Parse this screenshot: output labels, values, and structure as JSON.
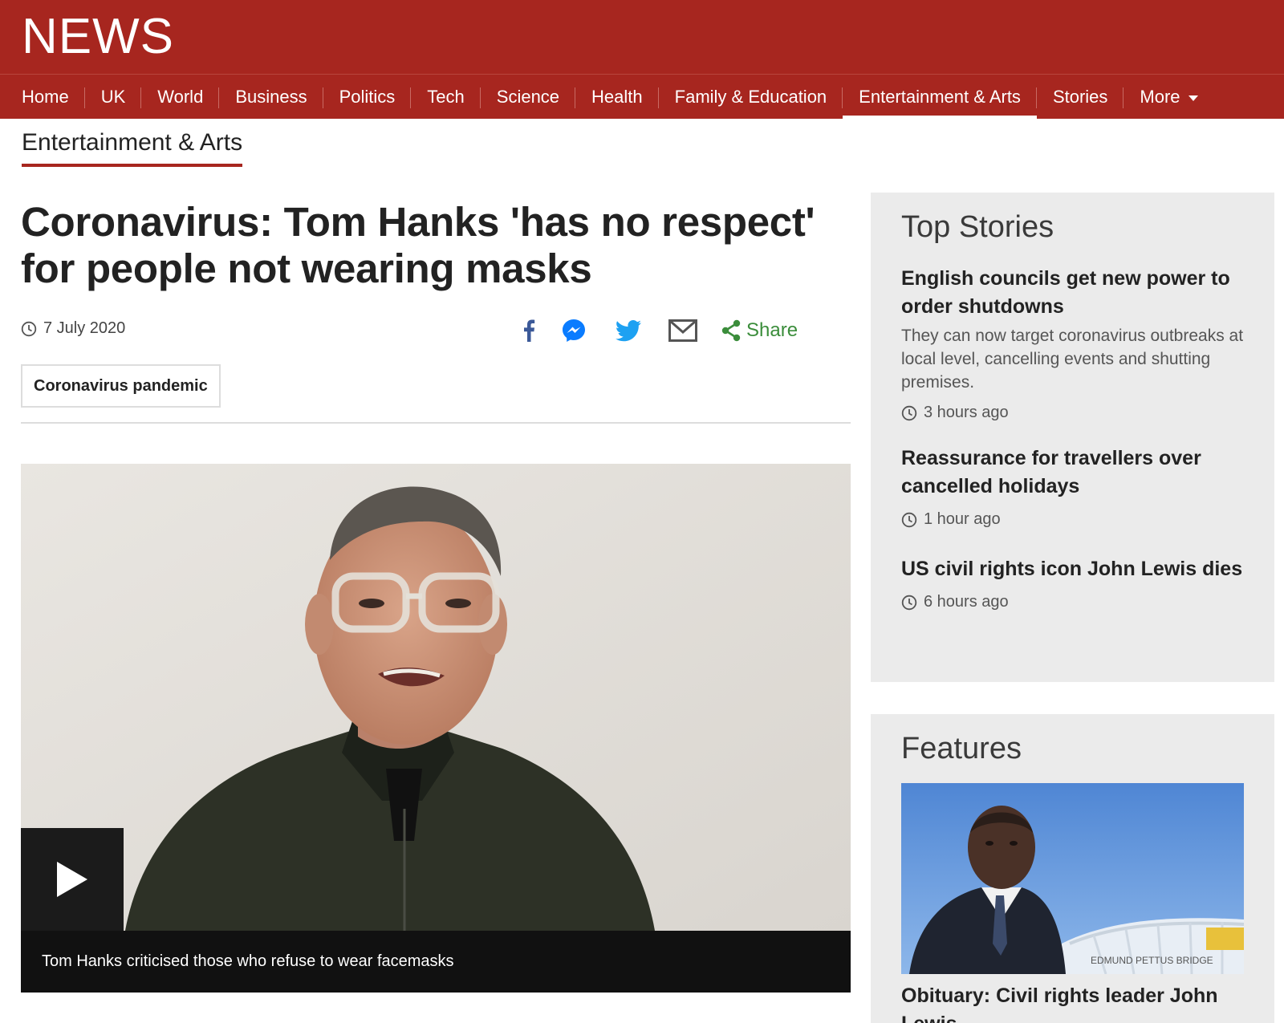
{
  "brand": {
    "logo_text": "NEWS",
    "accent": "#a7261f"
  },
  "nav": {
    "items": [
      {
        "label": "Home"
      },
      {
        "label": "UK"
      },
      {
        "label": "World"
      },
      {
        "label": "Business"
      },
      {
        "label": "Politics"
      },
      {
        "label": "Tech"
      },
      {
        "label": "Science"
      },
      {
        "label": "Health"
      },
      {
        "label": "Family & Education"
      },
      {
        "label": "Entertainment & Arts",
        "active": true
      },
      {
        "label": "Stories"
      },
      {
        "label": "More"
      }
    ]
  },
  "section": {
    "label": "Entertainment & Arts"
  },
  "article": {
    "headline": "Coronavirus: Tom Hanks 'has no respect' for people not wearing masks",
    "date": "7 July 2020",
    "tag": "Coronavirus pandemic",
    "video_caption": "Tom Hanks criticised those who refuse to wear facemasks"
  },
  "share": {
    "icons": [
      "facebook-icon",
      "messenger-icon",
      "twitter-icon",
      "email-icon",
      "share-icon"
    ],
    "label": "Share",
    "label_color": "#3b8d3b"
  },
  "top_stories": {
    "title": "Top Stories",
    "items": [
      {
        "title": "English councils get new power to order shutdowns",
        "summary": "They can now target coronavirus outbreaks at local level, cancelling events and shutting premises.",
        "time": "3 hours ago"
      },
      {
        "title": "Reassurance for travellers over cancelled holidays",
        "time": "1 hour ago"
      },
      {
        "title": "US civil rights icon John Lewis dies",
        "time": "6 hours ago"
      }
    ]
  },
  "features": {
    "title": "Features",
    "items": [
      {
        "title": "Obituary: Civil rights leader John Lewis",
        "image_sign_text": "EDMUND PETTUS BRIDGE"
      }
    ]
  }
}
